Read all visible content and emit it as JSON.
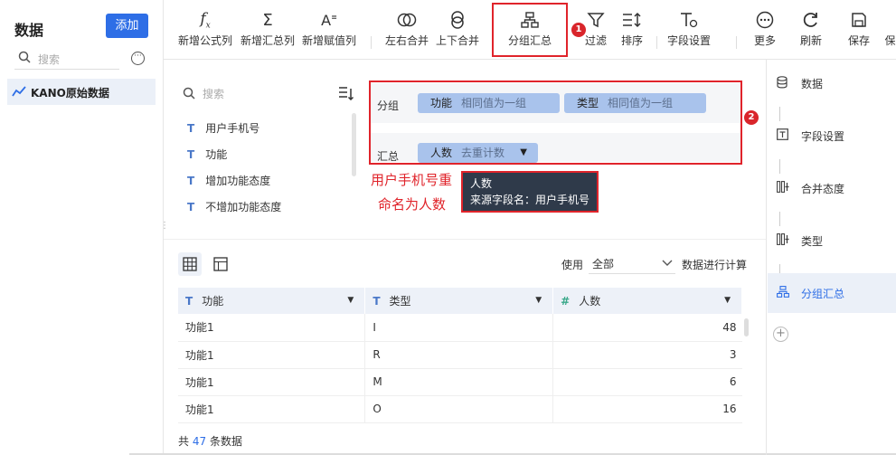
{
  "sidebar": {
    "title": "数据",
    "add_label": "添加",
    "search_placeholder": "搜索",
    "dataset": "KANO原始数据"
  },
  "toolbar": {
    "items": [
      {
        "label": "新增公式列",
        "icon": "fx-icon"
      },
      {
        "label": "新增汇总列",
        "icon": "sigma-icon"
      },
      {
        "label": "新增赋值列",
        "icon": "assign-icon"
      },
      {
        "label": "左右合并",
        "icon": "merge-horizontal-icon"
      },
      {
        "label": "上下合并",
        "icon": "merge-vertical-icon"
      },
      {
        "label": "分组汇总",
        "icon": "group-summary-icon"
      },
      {
        "label": "过滤",
        "icon": "filter-icon"
      },
      {
        "label": "排序",
        "icon": "sort-icon"
      },
      {
        "label": "字段设置",
        "icon": "field-settings-icon"
      },
      {
        "label": "更多",
        "icon": "more-icon"
      },
      {
        "label": "刷新",
        "icon": "refresh-icon"
      },
      {
        "label": "保存",
        "icon": "save-icon"
      },
      {
        "label": "保",
        "icon": "save-as-icon"
      }
    ],
    "badge1": "1"
  },
  "fields": {
    "search_placeholder": "搜索",
    "items": [
      "用户手机号",
      "功能",
      "增加功能态度",
      "不增加功能态度"
    ],
    "type_glyph": "T"
  },
  "config": {
    "group_label": "分组",
    "summary_label": "汇总",
    "group_chips": [
      {
        "name": "功能",
        "desc": "相同值为一组"
      },
      {
        "name": "类型",
        "desc": "相同值为一组"
      }
    ],
    "summary_chip": {
      "name": "人数",
      "desc": "去重计数"
    },
    "badge2": "2"
  },
  "annotation": {
    "line1": "用户手机号重",
    "line2": "命名为人数"
  },
  "tooltip": {
    "title": "人数",
    "source": "来源字段名：用户手机号"
  },
  "preview": {
    "use_label": "使用",
    "use_value": "全部",
    "calc_label": "数据进行计算",
    "columns": [
      {
        "name": "功能",
        "type": "T"
      },
      {
        "name": "类型",
        "type": "T"
      },
      {
        "name": "人数",
        "type": "#"
      }
    ],
    "rows": [
      [
        "功能1",
        "I",
        "48"
      ],
      [
        "功能1",
        "R",
        "3"
      ],
      [
        "功能1",
        "M",
        "6"
      ],
      [
        "功能1",
        "O",
        "16"
      ]
    ],
    "count_prefix": "共",
    "count": "47",
    "count_suffix": "条数据"
  },
  "steps": [
    {
      "label": "数据",
      "icon": "database-icon"
    },
    {
      "label": "字段设置",
      "icon": "field-settings-icon"
    },
    {
      "label": "合并态度",
      "icon": "merge-column-icon"
    },
    {
      "label": "类型",
      "icon": "merge-column-icon"
    },
    {
      "label": "分组汇总",
      "icon": "group-summary-icon"
    }
  ],
  "colors": {
    "accent": "#2e6ee6",
    "highlight_red": "#e0242b",
    "chip_blue": "#a9c3ec",
    "active_bg": "#ebf0f8"
  }
}
